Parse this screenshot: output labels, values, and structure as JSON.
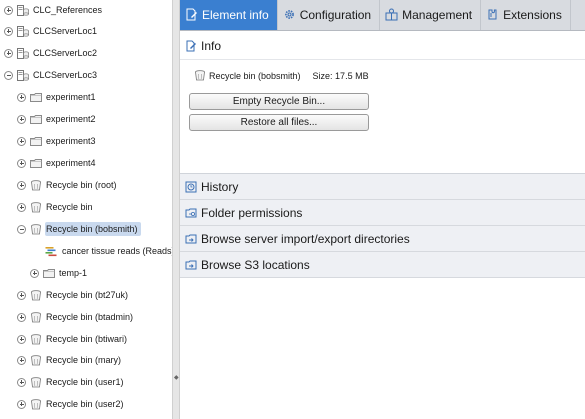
{
  "tree": {
    "items": [
      {
        "label": "CLC_References",
        "expander": "plus",
        "icon": "server-db-icon"
      },
      {
        "label": "CLCServerLoc1",
        "expander": "plus",
        "icon": "server-db-icon"
      },
      {
        "label": "CLCServerLoc2",
        "expander": "plus",
        "icon": "server-db-icon"
      },
      {
        "label": "CLCServerLoc3",
        "expander": "minus",
        "icon": "server-db-icon"
      },
      {
        "label": "experiment1",
        "expander": "plus",
        "icon": "folder-icon"
      },
      {
        "label": "experiment2",
        "expander": "plus",
        "icon": "folder-icon"
      },
      {
        "label": "experiment3",
        "expander": "plus",
        "icon": "folder-icon"
      },
      {
        "label": "experiment4",
        "expander": "plus",
        "icon": "folder-icon"
      },
      {
        "label": "Recycle bin (root)",
        "expander": "plus",
        "icon": "recycle-bin-icon"
      },
      {
        "label": "Recycle bin",
        "expander": "plus",
        "icon": "recycle-bin-icon"
      },
      {
        "label": "Recycle bin (bobsmith)",
        "expander": "minus",
        "icon": "recycle-bin-icon",
        "selected": true
      },
      {
        "label": "cancer tissue reads (Reads)",
        "expander": "none",
        "icon": "sequence-reads-icon"
      },
      {
        "label": "temp-1",
        "expander": "plus",
        "icon": "folder-icon"
      },
      {
        "label": "Recycle bin (bt27uk)",
        "expander": "plus",
        "icon": "recycle-bin-icon"
      },
      {
        "label": "Recycle bin (btadmin)",
        "expander": "plus",
        "icon": "recycle-bin-icon"
      },
      {
        "label": "Recycle bin (btiwari)",
        "expander": "plus",
        "icon": "recycle-bin-icon"
      },
      {
        "label": "Recycle bin (mary)",
        "expander": "plus",
        "icon": "recycle-bin-icon"
      },
      {
        "label": "Recycle bin (user1)",
        "expander": "plus",
        "icon": "recycle-bin-icon"
      },
      {
        "label": "Recycle bin (user2)",
        "expander": "plus",
        "icon": "recycle-bin-icon"
      }
    ]
  },
  "tabs": [
    {
      "label": "Element info",
      "icon": "document-edit-icon",
      "active": true
    },
    {
      "label": "Configuration",
      "icon": "gear-icon"
    },
    {
      "label": "Management",
      "icon": "management-icon"
    },
    {
      "label": "Extensions",
      "icon": "puzzle-icon"
    }
  ],
  "info": {
    "title": "Info",
    "bin_name": "Recycle bin (bobsmith)",
    "size_label": "Size: 17.5 MB",
    "empty_button": "Empty Recycle Bin...",
    "restore_button": "Restore all files..."
  },
  "sections": [
    {
      "label": "History",
      "icon": "history-icon"
    },
    {
      "label": "Folder permissions",
      "icon": "folder-permissions-icon"
    },
    {
      "label": "Browse server import/export directories",
      "icon": "browse-server-icon"
    },
    {
      "label": "Browse S3 locations",
      "icon": "browse-s3-icon"
    }
  ],
  "colors": {
    "active_tab": "#3a7fd0",
    "tab_bar": "#d8dbe0",
    "selection": "#c9d9ee",
    "section_bg": "#eef0f4"
  }
}
